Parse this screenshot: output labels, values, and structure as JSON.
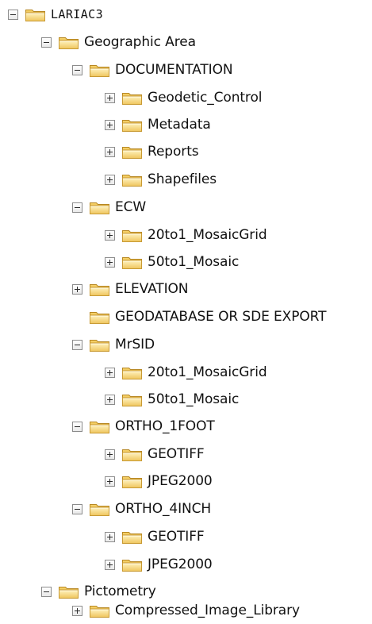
{
  "tree": {
    "root": {
      "label": "LARIAC3"
    },
    "geographic_area": {
      "label": "Geographic Area"
    },
    "documentation": {
      "label": "DOCUMENTATION",
      "children": [
        {
          "label": "Geodetic_Control"
        },
        {
          "label": "Metadata"
        },
        {
          "label": "Reports"
        },
        {
          "label": "Shapefiles"
        }
      ]
    },
    "ecw": {
      "label": "ECW",
      "children": [
        {
          "label": "20to1_MosaicGrid"
        },
        {
          "label": "50to1_Mosaic"
        }
      ]
    },
    "elevation": {
      "label": "ELEVATION"
    },
    "geodatabase": {
      "label": "GEODATABASE OR SDE EXPORT"
    },
    "mrsid": {
      "label": "MrSID",
      "children": [
        {
          "label": "20to1_MosaicGrid"
        },
        {
          "label": "50to1_Mosaic"
        }
      ]
    },
    "ortho_1foot": {
      "label": "ORTHO_1FOOT",
      "children": [
        {
          "label": "GEOTIFF"
        },
        {
          "label": "JPEG2000"
        }
      ]
    },
    "ortho_4inch": {
      "label": "ORTHO_4INCH",
      "children": [
        {
          "label": "GEOTIFF"
        },
        {
          "label": "JPEG2000"
        }
      ]
    },
    "pictometry": {
      "label": "Pictometry",
      "children": [
        {
          "label": "Compressed_Image_Library"
        }
      ]
    }
  }
}
